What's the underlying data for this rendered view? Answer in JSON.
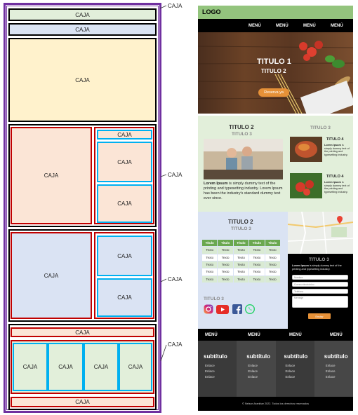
{
  "wireframe": {
    "box_label": "CAJA",
    "side_label": "CAJA"
  },
  "mockup": {
    "logo": "LOGO",
    "nav": [
      "MENÚ",
      "MENÚ",
      "MENÚ",
      "MENÚ"
    ],
    "hero": {
      "title1": "TITULO 1",
      "title2": "TITULO 2",
      "button": "Reserva ya"
    },
    "section2": {
      "title": "TITULO 2",
      "subtitle": "TITULO 3",
      "aside_title": "TITULO 3",
      "body_bold": "Lorem Ipsum",
      "body": " is simply dummy text of the printing and typesetting industry. Lorem Ipsum has been the industry's standard dummy text ever since.",
      "cards": [
        {
          "title": "TITULO 4",
          "bold": "Lorem Ipsum",
          "text": " is simply dummy text of the printing and typesetting industry."
        },
        {
          "title": "TITULO 4",
          "bold": "Lorem Ipsum",
          "text": " is simply dummy text of the printing and typesetting industry."
        }
      ]
    },
    "section3": {
      "title": "TITULO 2",
      "subtitle": "TITULO 3",
      "table_header": [
        "Título",
        "Título",
        "Título",
        "Título",
        "Título"
      ],
      "table_cell": "Texto",
      "social_title": "TITULO 3",
      "form_title": "TITULO 3",
      "form_bold": "Lorem Ipsum",
      "form_text": " is simply dummy text of the printing and typesetting industry.",
      "fields": [
        "Nombre",
        "Correo electrónico",
        "Teléfono",
        "Mensaje"
      ],
      "send": "Enviar"
    },
    "nav2": [
      "MENÚ",
      "MENÚ",
      "MENÚ",
      "MENÚ"
    ],
    "footer": {
      "columns": [
        {
          "title": "subtítulo",
          "links": [
            "Enlace",
            "Enlace",
            "Enlace"
          ]
        },
        {
          "title": "subtítulo",
          "links": [
            "Enlace",
            "Enlace",
            "Enlace"
          ]
        },
        {
          "title": "subtítulo",
          "links": [
            "Enlace",
            "Enlace",
            "Enlace"
          ]
        },
        {
          "title": "subtítulo",
          "links": [
            "Enlace",
            "Enlace",
            "Enlace"
          ]
        }
      ],
      "copyright": "© Nelson Aranibar 2022. Todos los derechos reservados"
    }
  },
  "colors": {
    "purple": "#7030a0",
    "green_box": "#e2efda",
    "blue_box": "#dae3f3",
    "yellow_box": "#fff2cc",
    "peach_box": "#fbe5d6",
    "red": "#c00000",
    "cyan": "#00b0f0"
  }
}
